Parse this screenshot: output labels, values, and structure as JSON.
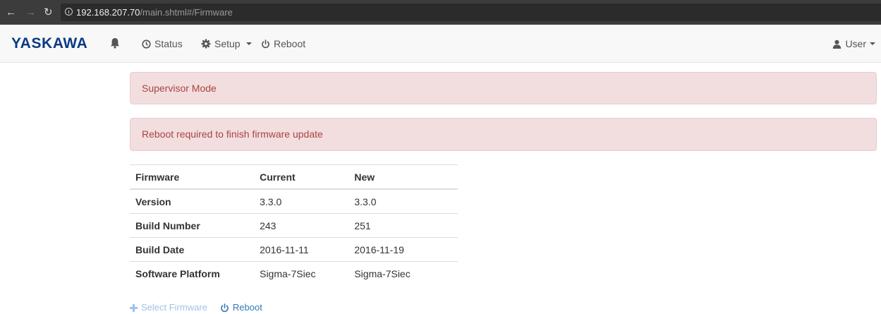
{
  "browser": {
    "url_host": "192.168.207.70",
    "url_path": "/main.shtml#/Firmware"
  },
  "navbar": {
    "brand": "YASKAWA",
    "items": [
      {
        "label": "Status",
        "icon": "clock-icon"
      },
      {
        "label": "Setup",
        "icon": "gear-icon",
        "dropdown": true
      },
      {
        "label": "Reboot",
        "icon": "power-icon"
      }
    ],
    "user_label": "User"
  },
  "alerts": [
    {
      "text": "Supervisor Mode"
    },
    {
      "text": "Reboot required to finish firmware update"
    }
  ],
  "firmware_table": {
    "headers": [
      "Firmware",
      "Current",
      "New"
    ],
    "rows": [
      {
        "label": "Version",
        "current": "3.3.0",
        "new": "3.3.0"
      },
      {
        "label": "Build Number",
        "current": "243",
        "new": "251"
      },
      {
        "label": "Build Date",
        "current": "2016-11-11",
        "new": "2016-11-19"
      },
      {
        "label": "Software Platform",
        "current": "Sigma-7Siec",
        "new": "Sigma-7Siec"
      }
    ]
  },
  "actions": {
    "select_firmware": "Select Firmware",
    "reboot": "Reboot"
  },
  "colors": {
    "brand": "#0a3a85",
    "alert_bg": "#f2dede",
    "alert_text": "#a94442",
    "link": "#337ab7"
  }
}
